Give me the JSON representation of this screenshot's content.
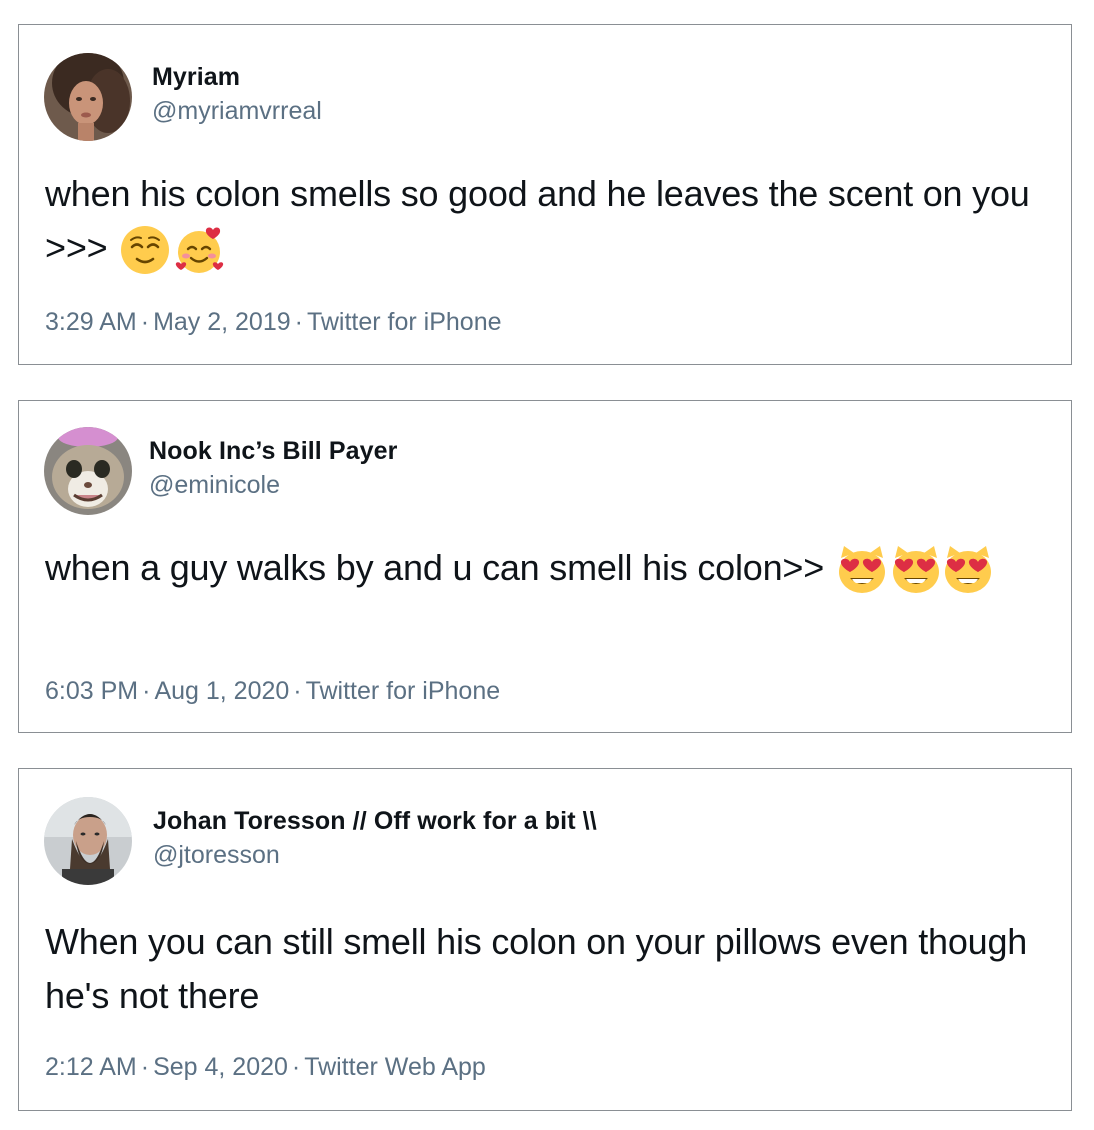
{
  "tweets": [
    {
      "name": "Myriam",
      "handle": "@myriamvrreal",
      "text": "when his colon smells so good and he leaves the scent on you >>>",
      "emojis": [
        "relieved-face",
        "smiling-face-with-hearts"
      ],
      "time": "3:29 AM",
      "date": "May 2, 2019",
      "source": "Twitter for iPhone"
    },
    {
      "name": "Nook Inc’s Bill Payer",
      "handle": "@eminicole",
      "text": "when a guy walks by and u can smell his colon>>",
      "emojis": [
        "smiling-cat-heart-eyes",
        "smiling-cat-heart-eyes",
        "smiling-cat-heart-eyes"
      ],
      "time": "6:03 PM",
      "date": "Aug 1, 2020",
      "source": "Twitter for iPhone"
    },
    {
      "name": "Johan Toresson // Off work for a bit \\\\",
      "handle": "@jtoresson",
      "text": "When you can still smell his colon on your pillows even though he's not there",
      "emojis": [],
      "time": "2:12 AM",
      "date": "Sep 4, 2020",
      "source": "Twitter Web App"
    }
  ],
  "meta_separator": "·",
  "colors": {
    "text": "#0f1419",
    "secondary": "#5b7083",
    "border": "#8a8f94"
  }
}
